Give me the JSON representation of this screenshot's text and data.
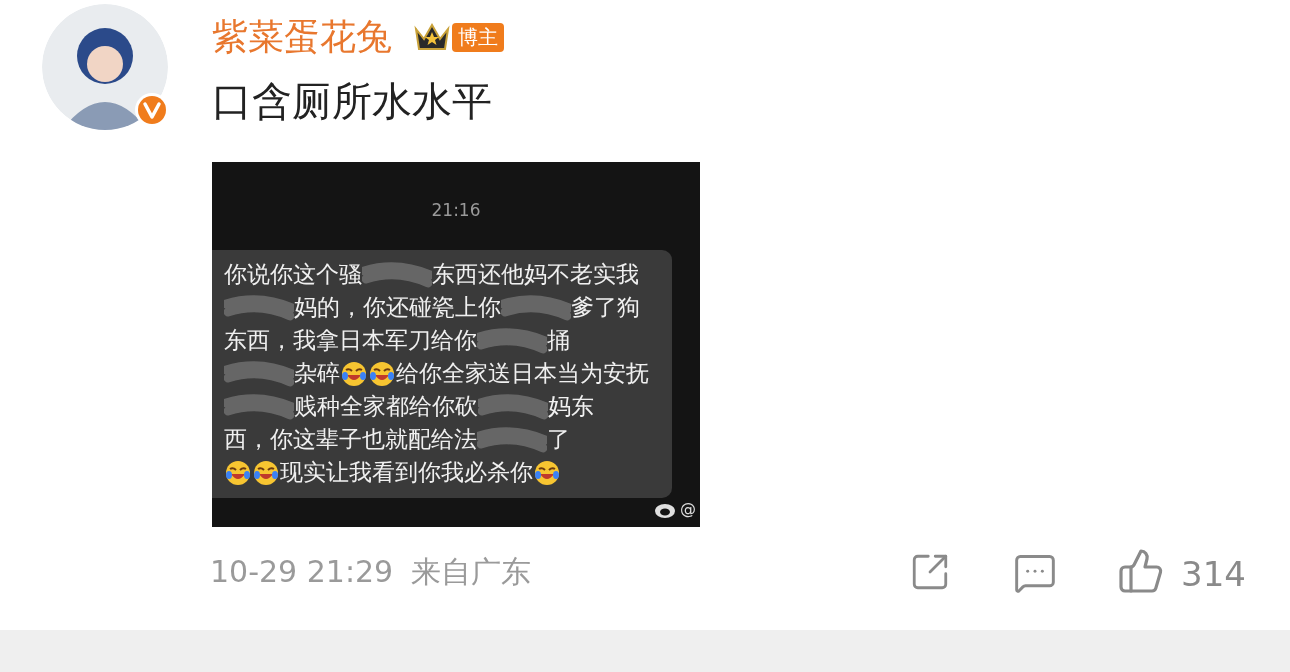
{
  "author": {
    "name": "紫菜蛋花兔",
    "badge": "博主",
    "verified": true
  },
  "post": {
    "text": "口含厕所水水平",
    "image": {
      "time": "21:16",
      "watermark": "@",
      "lines": [
        [
          {
            "kind": "text",
            "text": "你说你这个骚"
          },
          {
            "kind": "scribble"
          },
          {
            "kind": "text",
            "text": "东西还他妈不老实我"
          }
        ],
        [
          {
            "kind": "scribble"
          },
          {
            "kind": "text",
            "text": "妈的，你还碰瓷上你"
          },
          {
            "kind": "scribble"
          },
          {
            "kind": "text",
            "text": "爹了狗"
          }
        ],
        [
          {
            "kind": "text",
            "text": "东西，我拿日本军刀给你"
          },
          {
            "kind": "scribble"
          },
          {
            "kind": "text",
            "text": "捅"
          }
        ],
        [
          {
            "kind": "scribble"
          },
          {
            "kind": "text",
            "text": "杂碎"
          },
          {
            "kind": "emoji"
          },
          {
            "kind": "emoji"
          },
          {
            "kind": "text",
            "text": "给你全家送日本当为安抚"
          }
        ],
        [
          {
            "kind": "scribble"
          },
          {
            "kind": "text",
            "text": "贱种全家都给你砍"
          },
          {
            "kind": "scribble"
          },
          {
            "kind": "text",
            "text": "妈东"
          }
        ],
        [
          {
            "kind": "text",
            "text": "西，你这辈子也就配给法"
          },
          {
            "kind": "scribble"
          },
          {
            "kind": "text",
            "text": "了"
          }
        ],
        [
          {
            "kind": "emoji"
          },
          {
            "kind": "emoji"
          },
          {
            "kind": "text",
            "text": "现实让我看到你我必杀你"
          },
          {
            "kind": "emoji"
          }
        ]
      ]
    }
  },
  "footer": {
    "date": "10-29 21:29",
    "location": "来自广东",
    "likes": "314"
  }
}
